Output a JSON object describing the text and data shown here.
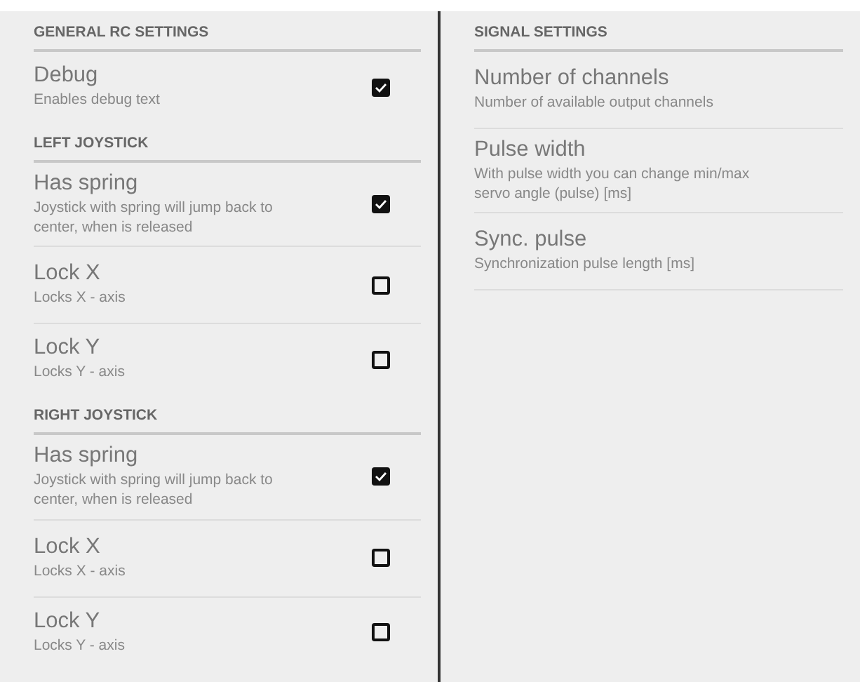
{
  "left_pane": {
    "sections": [
      {
        "header": "GENERAL RC SETTINGS",
        "items": [
          {
            "kind": "checkbox",
            "title": "Debug",
            "summary": "Enables debug text",
            "checked": true
          }
        ]
      },
      {
        "header": "LEFT JOYSTICK",
        "items": [
          {
            "kind": "checkbox",
            "title": "Has spring",
            "summary": "Joystick with spring will jump back to center, when is released",
            "checked": true
          },
          {
            "kind": "checkbox",
            "title": "Lock X",
            "summary": "Locks X - axis",
            "checked": false
          },
          {
            "kind": "checkbox",
            "title": "Lock Y",
            "summary": "Locks Y - axis",
            "checked": false
          }
        ]
      },
      {
        "header": "RIGHT JOYSTICK",
        "items": [
          {
            "kind": "checkbox",
            "title": "Has spring",
            "summary": "Joystick with spring will jump back to center, when is released",
            "checked": true
          },
          {
            "kind": "checkbox",
            "title": "Lock X",
            "summary": "Locks X - axis",
            "checked": false
          },
          {
            "kind": "checkbox",
            "title": "Lock Y",
            "summary": "Locks Y - axis",
            "checked": false
          }
        ]
      }
    ]
  },
  "right_pane": {
    "sections": [
      {
        "header": "SIGNAL SETTINGS",
        "items": [
          {
            "title": "Number of channels",
            "summary": "Number of available output channels"
          },
          {
            "title": "Pulse width",
            "summary": "With pulse width you can change min/max servo angle (pulse) [ms]"
          },
          {
            "title": "Sync. pulse",
            "summary": "Synchronization pulse length [ms]"
          }
        ]
      }
    ]
  }
}
